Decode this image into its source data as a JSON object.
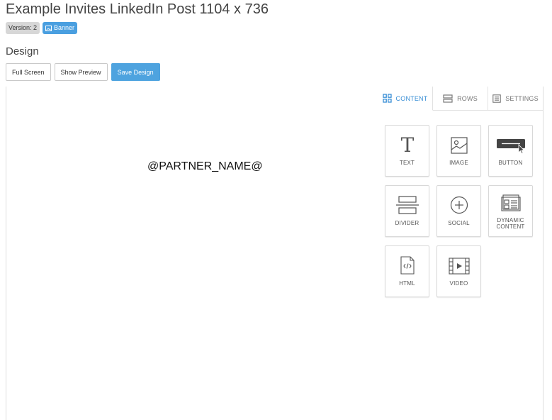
{
  "header": {
    "title": "Example Invites LinkedIn Post 1104 x 736",
    "version_badge": "Version: 2",
    "type_badge": "Banner"
  },
  "design": {
    "section_title": "Design",
    "full_screen_label": "Full Screen",
    "show_preview_label": "Show Preview",
    "save_design_label": "Save Design"
  },
  "canvas": {
    "placeholder_text": "@PARTNER_NAME@"
  },
  "panel": {
    "tabs": [
      {
        "label": "CONTENT",
        "icon": "grid-icon",
        "active": true
      },
      {
        "label": "ROWS",
        "icon": "rows-icon",
        "active": false
      },
      {
        "label": "SETTINGS",
        "icon": "settings-icon",
        "active": false
      }
    ],
    "blocks": [
      {
        "label": "TEXT",
        "icon": "text-icon"
      },
      {
        "label": "IMAGE",
        "icon": "image-icon"
      },
      {
        "label": "BUTTON",
        "icon": "button-icon"
      },
      {
        "label": "DIVIDER",
        "icon": "divider-icon"
      },
      {
        "label": "SOCIAL",
        "icon": "social-icon"
      },
      {
        "label": "DYNAMIC CONTENT",
        "icon": "dynamic-content-icon"
      },
      {
        "label": "HTML",
        "icon": "html-icon"
      },
      {
        "label": "VIDEO",
        "icon": "video-icon"
      }
    ]
  },
  "colors": {
    "accent": "#4ea3df",
    "active_tab": "#3a8fd6",
    "badge_grey": "#d7d7d7"
  }
}
